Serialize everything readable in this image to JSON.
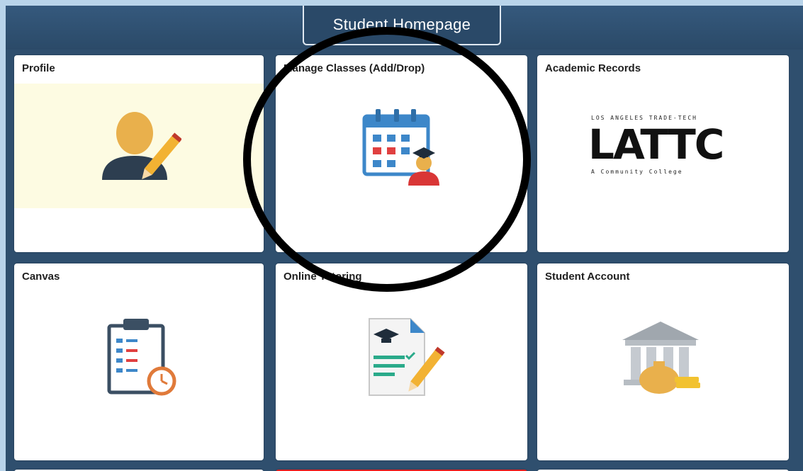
{
  "header": {
    "home_button_label": "Student Homepage"
  },
  "tiles": [
    {
      "title": "Profile",
      "icon": "profile-user-pencil-icon"
    },
    {
      "title": "Manage Classes (Add/Drop)",
      "icon": "calendar-student-icon"
    },
    {
      "title": "Academic Records",
      "icon": "lattc-logo"
    },
    {
      "title": "Canvas",
      "icon": "clipboard-clock-icon"
    },
    {
      "title": "Online Tutoring",
      "icon": "document-graduation-pencil-icon"
    },
    {
      "title": "Student Account",
      "icon": "bank-money-bag-icon"
    }
  ],
  "logo": {
    "top_text": "LOS ANGELES TRADE-TECH",
    "main_text": "LATTC",
    "bottom_text": "A Community College"
  },
  "colors": {
    "frame": "#2f4f6e",
    "profile_tile_bg": "#fdfbe2",
    "highlight_circle": "#000000",
    "red_tab": "#e81e1e"
  }
}
